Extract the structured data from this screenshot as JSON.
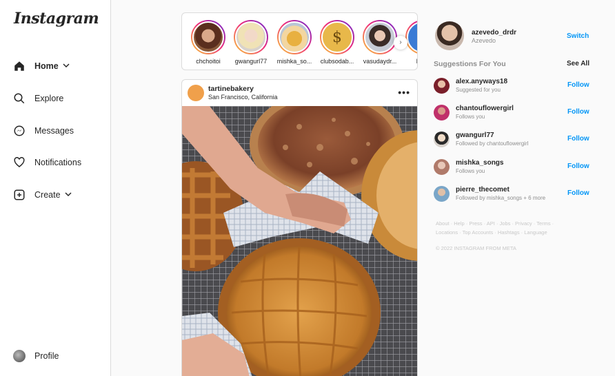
{
  "app": {
    "logo": "Instagram"
  },
  "sidebar": {
    "items": [
      {
        "label": "Home",
        "icon": "home-icon",
        "has_chevron": true
      },
      {
        "label": "Explore",
        "icon": "search-icon"
      },
      {
        "label": "Messages",
        "icon": "messenger-icon"
      },
      {
        "label": "Notifications",
        "icon": "heart-icon"
      },
      {
        "label": "Create",
        "icon": "plus-square-icon",
        "has_chevron": true
      }
    ],
    "profile_label": "Profile"
  },
  "stories": [
    {
      "name": "chchoitoi"
    },
    {
      "name": "gwangurl77"
    },
    {
      "name": "mishka_so..."
    },
    {
      "name": "clubsodab..."
    },
    {
      "name": "vasudaydr..."
    },
    {
      "name": "hi_ki"
    }
  ],
  "post": {
    "username": "tartinebakery",
    "location": "San Francisco, California",
    "more": "•••"
  },
  "current_user": {
    "username": "azevedo_drdr",
    "name": "Azevedo",
    "switch_label": "Switch"
  },
  "suggestions": {
    "title": "Suggestions For You",
    "see_all": "See All",
    "follow_label": "Follow",
    "items": [
      {
        "username": "alex.anyways18",
        "subtitle": "Suggested for you"
      },
      {
        "username": "chantouflowergirl",
        "subtitle": "Follows you"
      },
      {
        "username": "gwangurl77",
        "subtitle": "Followed by chantouflowergirl"
      },
      {
        "username": "mishka_songs",
        "subtitle": "Follows you"
      },
      {
        "username": "pierre_thecomet",
        "subtitle": "Followed by mishka_songs + 6 more"
      }
    ]
  },
  "footer": {
    "line1": "About · Help · Press · API · Jobs · Privacy · Terms ·",
    "line2": "Locations · Top Accounts · Hashtags · Language",
    "copyright": "© 2022 INSTAGRAM FROM META"
  },
  "colors": {
    "accent": "#0095f6",
    "text": "#262626",
    "muted": "#8e8e8e"
  }
}
